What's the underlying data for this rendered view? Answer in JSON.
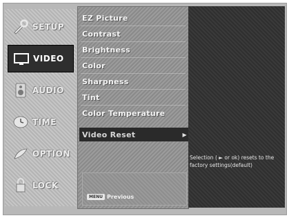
{
  "nav": {
    "items": [
      {
        "label": "SETUP",
        "icon": "setup-wrench-icon"
      },
      {
        "label": "VIDEO",
        "icon": "tv-screen-icon"
      },
      {
        "label": "AUDIO",
        "icon": "speaker-icon"
      },
      {
        "label": "TIME",
        "icon": "clock-icon"
      },
      {
        "label": "OPTION",
        "icon": "option-gear-icon"
      },
      {
        "label": "LOCK",
        "icon": "padlock-icon"
      }
    ],
    "active": "VIDEO"
  },
  "menu": {
    "items": [
      "EZ Picture",
      "Contrast",
      "Brightness",
      "Color",
      "Sharpness",
      "Tint",
      "Color Temperature",
      "Video Reset"
    ],
    "selected": "Video Reset",
    "preview": {
      "button_label": "MENU",
      "caption": "Previous"
    }
  },
  "help_text": "Selection ( ► or ok) resets to the factory settings(default)",
  "colors": {
    "background": "#b8b8b8",
    "active_nav": "#2e2e2e",
    "selection_bar": "#2a2a2a",
    "panel": "#333333"
  }
}
